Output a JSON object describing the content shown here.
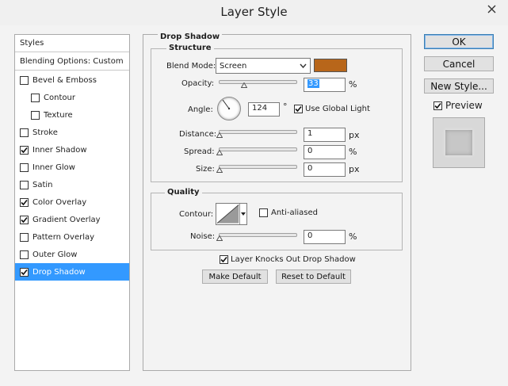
{
  "window": {
    "title": "Layer Style",
    "close_icon": "close-icon"
  },
  "left_panel": {
    "styles_header": "Styles",
    "blending_options": "Blending Options: Custom",
    "items": [
      {
        "label": "Bevel & Emboss",
        "checked": false
      },
      {
        "label": "Contour",
        "checked": false
      },
      {
        "label": "Texture",
        "checked": false
      },
      {
        "label": "Stroke",
        "checked": false
      },
      {
        "label": "Inner Shadow",
        "checked": true
      },
      {
        "label": "Inner Glow",
        "checked": false
      },
      {
        "label": "Satin",
        "checked": false
      },
      {
        "label": "Color Overlay",
        "checked": true
      },
      {
        "label": "Gradient Overlay",
        "checked": true
      },
      {
        "label": "Pattern Overlay",
        "checked": false
      },
      {
        "label": "Outer Glow",
        "checked": false
      },
      {
        "label": "Drop Shadow",
        "checked": true,
        "selected": true
      }
    ]
  },
  "drop_shadow": {
    "section_title": "Drop Shadow",
    "structure": {
      "title": "Structure",
      "blend_mode_label": "Blend Mode:",
      "blend_mode_value": "Screen",
      "blend_color": "#b8661a",
      "opacity_label": "Opacity:",
      "opacity_value": "33",
      "opacity_unit": "%",
      "angle_label": "Angle:",
      "angle_value": "124",
      "angle_unit": "°",
      "use_global_light_label": "Use Global Light",
      "use_global_light_checked": true,
      "distance_label": "Distance:",
      "distance_value": "1",
      "distance_unit": "px",
      "spread_label": "Spread:",
      "spread_value": "0",
      "spread_unit": "%",
      "size_label": "Size:",
      "size_value": "0",
      "size_unit": "px"
    },
    "quality": {
      "title": "Quality",
      "contour_label": "Contour:",
      "anti_aliased_label": "Anti-aliased",
      "anti_aliased_checked": false,
      "noise_label": "Noise:",
      "noise_value": "0",
      "noise_unit": "%"
    },
    "knocks_out_label": "Layer Knocks Out Drop Shadow",
    "knocks_out_checked": true,
    "make_default_label": "Make Default",
    "reset_default_label": "Reset to Default"
  },
  "buttons": {
    "ok": "OK",
    "cancel": "Cancel",
    "new_style": "New Style..."
  },
  "preview": {
    "label": "Preview",
    "checked": true
  },
  "colors": {
    "selection": "#3399ff",
    "background": "#f3f3f3"
  }
}
